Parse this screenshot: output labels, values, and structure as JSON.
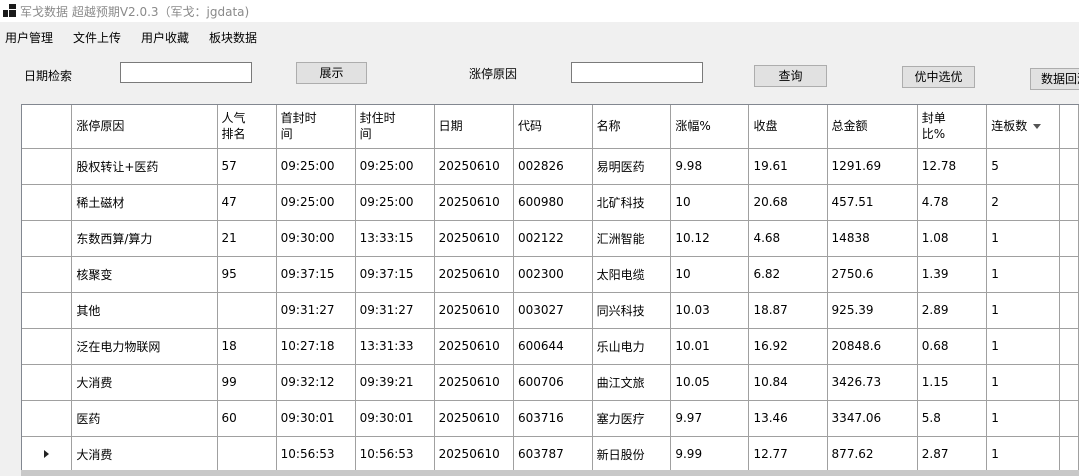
{
  "window": {
    "title": "军戈数据 超越预期V2.0.3（军戈：jgdata)"
  },
  "menu": [
    "用户管理",
    "文件上传",
    "用户收藏",
    "板块数据"
  ],
  "toolbar": {
    "date_label": "日期检索",
    "date_value": "",
    "show_button": "展示",
    "reason_label": "涨停原因",
    "reason_value": "",
    "query_button": "查询",
    "select_button": "优中选优",
    "backtest_button": "数据回测"
  },
  "grid": {
    "columns": [
      "涨停原因",
      "人气排名",
      "首封时间",
      "封住时间",
      "日期",
      "代码",
      "名称",
      "涨幅%",
      "收盘",
      "总金额",
      "封单比%",
      "连板数"
    ],
    "rows": [
      [
        "股权转让+医药",
        "57",
        "09:25:00",
        "09:25:00",
        "20250610",
        "002826",
        "易明医药",
        "9.98",
        "19.61",
        "1291.69",
        "12.78",
        "5"
      ],
      [
        "稀土磁材",
        "47",
        "09:25:00",
        "09:25:00",
        "20250610",
        "600980",
        "北矿科技",
        "10",
        "20.68",
        "457.51",
        "4.78",
        "2"
      ],
      [
        "东数西算/算力",
        "21",
        "09:30:00",
        "13:33:15",
        "20250610",
        "002122",
        "汇洲智能",
        "10.12",
        "4.68",
        "14838",
        "1.08",
        "1"
      ],
      [
        "核聚变",
        "95",
        "09:37:15",
        "09:37:15",
        "20250610",
        "002300",
        "太阳电缆",
        "10",
        "6.82",
        "2750.6",
        "1.39",
        "1"
      ],
      [
        "其他",
        "",
        "09:31:27",
        "09:31:27",
        "20250610",
        "003027",
        "同兴科技",
        "10.03",
        "18.87",
        "925.39",
        "2.89",
        "1"
      ],
      [
        "泛在电力物联网",
        "18",
        "10:27:18",
        "13:31:33",
        "20250610",
        "600644",
        "乐山电力",
        "10.01",
        "16.92",
        "20848.6",
        "0.68",
        "1"
      ],
      [
        "大消费",
        "99",
        "09:32:12",
        "09:39:21",
        "20250610",
        "600706",
        "曲江文旅",
        "10.05",
        "10.84",
        "3426.73",
        "1.15",
        "1"
      ],
      [
        "医药",
        "60",
        "09:30:01",
        "09:30:01",
        "20250610",
        "603716",
        "塞力医疗",
        "9.97",
        "13.46",
        "3347.06",
        "5.8",
        "1"
      ],
      [
        "大消费",
        "",
        "10:56:53",
        "10:56:53",
        "20250610",
        "603787",
        "新日股份",
        "9.99",
        "12.77",
        "877.62",
        "2.87",
        "1"
      ]
    ],
    "current_row_index": 8
  }
}
